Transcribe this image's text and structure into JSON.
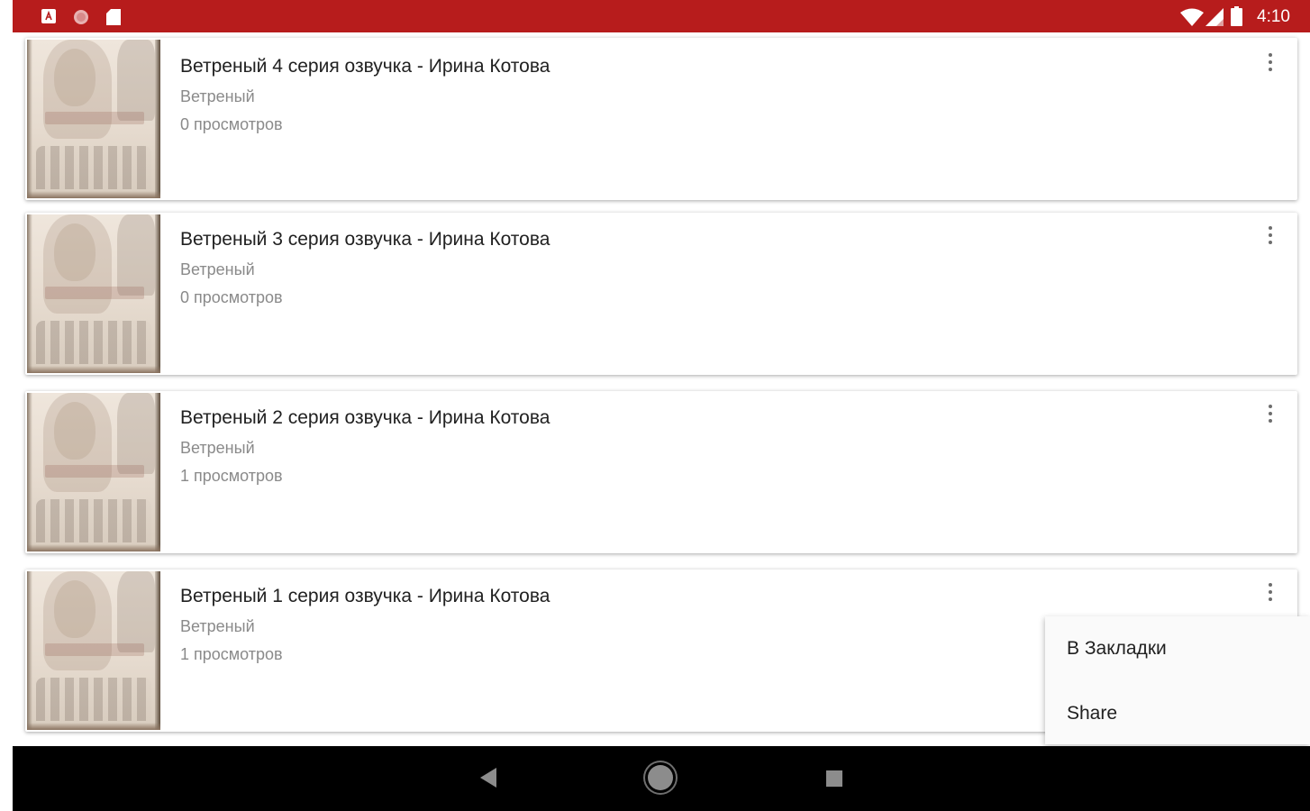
{
  "status_bar": {
    "time": "4:10",
    "left_icons": [
      "keyboard-a-icon",
      "record-icon",
      "sd-card-icon"
    ],
    "right_icons": [
      "wifi-icon",
      "cell-signal-icon",
      "battery-icon"
    ],
    "background_color": "#b71c1c"
  },
  "videos": [
    {
      "title": "Ветреный 4 серия озвучка - Ирина Котова",
      "series": "Ветреный",
      "views": "0 просмотров"
    },
    {
      "title": "Ветреный 3 серия озвучка - Ирина Котова",
      "series": "Ветреный",
      "views": "0 просмотров"
    },
    {
      "title": "Ветреный 2 серия озвучка - Ирина Котова",
      "series": "Ветреный",
      "views": "1 просмотров"
    },
    {
      "title": "Ветреный 1 серия озвучка - Ирина Котова",
      "series": "Ветреный",
      "views": "1 просмотров"
    }
  ],
  "popup_menu": {
    "items": [
      {
        "label": "В Закладки"
      },
      {
        "label": "Share"
      }
    ]
  },
  "nav_bar": {
    "buttons": [
      "back-icon",
      "home-icon",
      "recents-icon"
    ]
  }
}
